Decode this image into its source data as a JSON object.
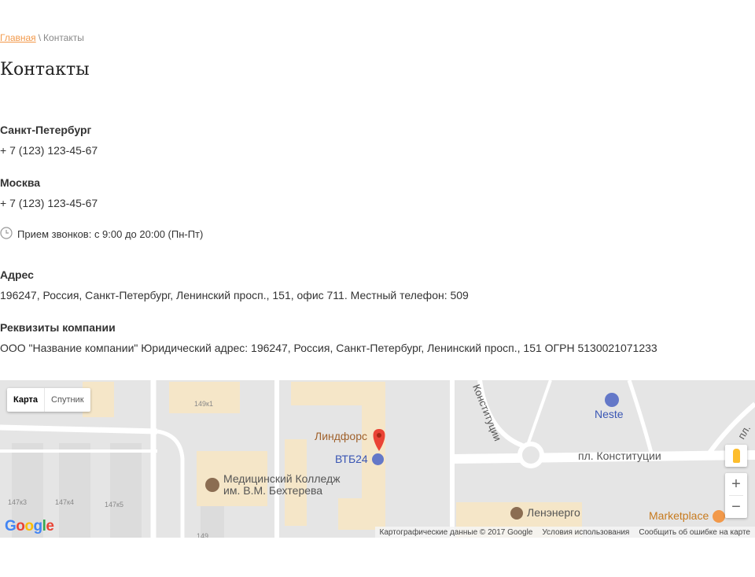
{
  "breadcrumb": {
    "home": "Главная",
    "separator": "\\",
    "current": "Контакты"
  },
  "page_title": "Контакты",
  "contacts": {
    "spb_title": "Санкт-Петербург",
    "spb_phone": "+ 7 (123) 123-45-67",
    "msk_title": "Москва",
    "msk_phone": "+ 7 (123) 123-45-67",
    "hours": "Прием звонков: с 9:00 до 20:00 (Пн-Пт)",
    "hours_icon": "clock-icon",
    "address_title": "Адрес",
    "address": "196247, Россия, Санкт-Петербург, Ленинский просп., 151, офис 711. Местный телефон: 509",
    "requisites_title": "Реквизиты компании",
    "requisites": "ООО \"Название компании\" Юридический адрес: 196247, Россия, Санкт-Петербург, Ленинский просп., 151 ОГРН 5130021071233"
  },
  "map": {
    "type_map": "Карта",
    "type_satellite": "Спутник",
    "zoom_in": "+",
    "zoom_out": "−",
    "poi_lindfors": "Линдфорс",
    "poi_vtb": "ВТБ24",
    "poi_college_1": "Медицинский Колледж",
    "poi_college_2": "им. В.М. Бехтерева",
    "poi_neste": "Neste",
    "poi_lenenergo": "Ленэнерго",
    "poi_marketplace": "Marketplace",
    "street_konst": "пл. Конституции",
    "street_konst_vert": "Конституции",
    "street_pl": "пл.",
    "bld_149k1": "149к1",
    "bld_147k3": "147к3",
    "bld_147k4": "147к4",
    "bld_147k5": "147к5",
    "bld_149": "149",
    "google": "Google",
    "attribution": "Картографические данные © 2017 Google",
    "terms": "Условия использования",
    "report": "Сообщить об ошибке на карте",
    "accent_color": "#f2994a"
  }
}
